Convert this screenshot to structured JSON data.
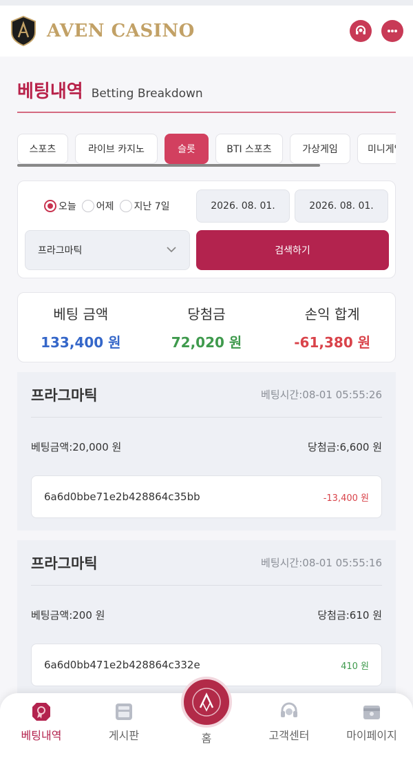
{
  "header": {
    "brand": "AVEN CASINO",
    "icons": [
      "headset-icon",
      "chat-icon"
    ]
  },
  "page": {
    "title_ko": "베팅내역",
    "title_en": "Betting Breakdown"
  },
  "tabs": [
    {
      "label": "스포츠",
      "active": false
    },
    {
      "label": "라이브 카지노",
      "active": false
    },
    {
      "label": "슬롯",
      "active": true
    },
    {
      "label": "BTI 스포츠",
      "active": false
    },
    {
      "label": "가상게임",
      "active": false
    },
    {
      "label": "미니게임",
      "active": false
    }
  ],
  "filter": {
    "radios": [
      {
        "label": "오늘",
        "selected": true
      },
      {
        "label": "어제",
        "selected": false
      },
      {
        "label": "지난 7일",
        "selected": false
      }
    ],
    "date_from": "2026. 08. 01.",
    "date_to": "2026. 08. 01.",
    "provider": "프라그마틱",
    "search_label": "검색하기"
  },
  "summary": {
    "bet_label": "베팅 금액",
    "bet_value": "133,400 원",
    "win_label": "당첨금",
    "win_value": "72,020 원",
    "pl_label": "손익 합계",
    "pl_value": "-61,380 원"
  },
  "bets": [
    {
      "name": "프라그마틱",
      "time": "베팅시간:08-01 05:55:26",
      "amount": "베팅금액:20,000 원",
      "win": "당첨금:6,600 원",
      "id": "6a6d0bbe71e2b428864c35bb",
      "pl": "-13,400 원",
      "pl_color": "#d9434a"
    },
    {
      "name": "프라그마틱",
      "time": "베팅시간:08-01 05:55:16",
      "amount": "베팅금액:200 원",
      "win": "당첨금:610 원",
      "id": "6a6d0bb471e2b428864c332e",
      "pl": "410 원",
      "pl_color": "#3f9a4d"
    }
  ],
  "nav": {
    "items": [
      "베팅내역",
      "게시판",
      "홈",
      "고객센터",
      "마이페이지"
    ]
  }
}
